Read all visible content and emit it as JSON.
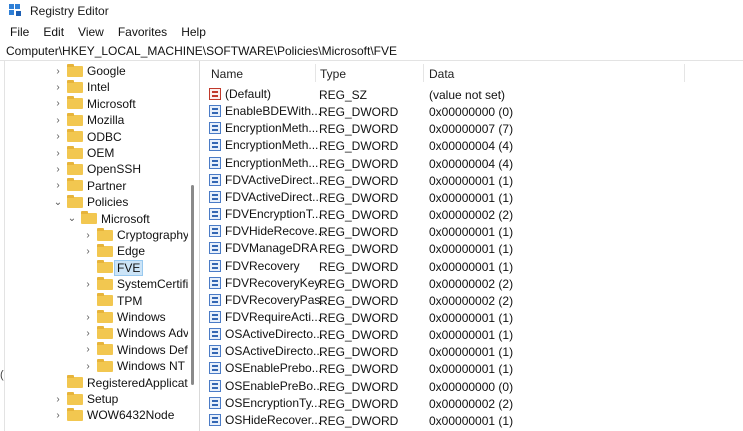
{
  "window": {
    "title": "Registry Editor"
  },
  "menu": [
    "File",
    "Edit",
    "View",
    "Favorites",
    "Help"
  ],
  "address": "Computer\\HKEY_LOCAL_MACHINE\\SOFTWARE\\Policies\\Microsoft\\FVE",
  "tree": [
    {
      "label": "Google",
      "depth": 0,
      "expander": "›"
    },
    {
      "label": "Intel",
      "depth": 0,
      "expander": "›"
    },
    {
      "label": "Microsoft",
      "depth": 0,
      "expander": "›"
    },
    {
      "label": "Mozilla",
      "depth": 0,
      "expander": "›"
    },
    {
      "label": "ODBC",
      "depth": 0,
      "expander": "›"
    },
    {
      "label": "OEM",
      "depth": 0,
      "expander": "›"
    },
    {
      "label": "OpenSSH",
      "depth": 0,
      "expander": "›"
    },
    {
      "label": "Partner",
      "depth": 0,
      "expander": "›"
    },
    {
      "label": "Policies",
      "depth": 0,
      "expander": "⌄"
    },
    {
      "label": "Microsoft",
      "depth": 1,
      "expander": "⌄"
    },
    {
      "label": "Cryptography",
      "depth": 2,
      "expander": "›"
    },
    {
      "label": "Edge",
      "depth": 2,
      "expander": "›"
    },
    {
      "label": "FVE",
      "depth": 2,
      "expander": "",
      "selected": true
    },
    {
      "label": "SystemCertific",
      "depth": 2,
      "expander": "›"
    },
    {
      "label": "TPM",
      "depth": 2,
      "expander": ""
    },
    {
      "label": "Windows",
      "depth": 2,
      "expander": "›"
    },
    {
      "label": "Windows Adva",
      "depth": 2,
      "expander": "›"
    },
    {
      "label": "Windows Defe",
      "depth": 2,
      "expander": "›"
    },
    {
      "label": "Windows NT",
      "depth": 2,
      "expander": "›"
    },
    {
      "label": "RegisteredApplicatic",
      "depth": 0,
      "expander": ""
    },
    {
      "label": "Setup",
      "depth": 0,
      "expander": "›"
    },
    {
      "label": "WOW6432Node",
      "depth": 0,
      "expander": "›"
    }
  ],
  "list": {
    "columns": {
      "name": "Name",
      "type": "Type",
      "data": "Data"
    },
    "rows": [
      {
        "name": "(Default)",
        "type": "REG_SZ",
        "data": "(value not set)",
        "icon": "string-value-icon"
      },
      {
        "name": "EnableBDEWith...",
        "type": "REG_DWORD",
        "data": "0x00000000 (0)",
        "icon": "binary-value-icon"
      },
      {
        "name": "EncryptionMeth...",
        "type": "REG_DWORD",
        "data": "0x00000007 (7)",
        "icon": "binary-value-icon"
      },
      {
        "name": "EncryptionMeth...",
        "type": "REG_DWORD",
        "data": "0x00000004 (4)",
        "icon": "binary-value-icon"
      },
      {
        "name": "EncryptionMeth...",
        "type": "REG_DWORD",
        "data": "0x00000004 (4)",
        "icon": "binary-value-icon"
      },
      {
        "name": "FDVActiveDirect...",
        "type": "REG_DWORD",
        "data": "0x00000001 (1)",
        "icon": "binary-value-icon"
      },
      {
        "name": "FDVActiveDirect...",
        "type": "REG_DWORD",
        "data": "0x00000001 (1)",
        "icon": "binary-value-icon"
      },
      {
        "name": "FDVEncryptionT...",
        "type": "REG_DWORD",
        "data": "0x00000002 (2)",
        "icon": "binary-value-icon"
      },
      {
        "name": "FDVHideRecove...",
        "type": "REG_DWORD",
        "data": "0x00000001 (1)",
        "icon": "binary-value-icon"
      },
      {
        "name": "FDVManageDRA",
        "type": "REG_DWORD",
        "data": "0x00000001 (1)",
        "icon": "binary-value-icon"
      },
      {
        "name": "FDVRecovery",
        "type": "REG_DWORD",
        "data": "0x00000001 (1)",
        "icon": "binary-value-icon"
      },
      {
        "name": "FDVRecoveryKey",
        "type": "REG_DWORD",
        "data": "0x00000002 (2)",
        "icon": "binary-value-icon"
      },
      {
        "name": "FDVRecoveryPas...",
        "type": "REG_DWORD",
        "data": "0x00000002 (2)",
        "icon": "binary-value-icon"
      },
      {
        "name": "FDVRequireActi...",
        "type": "REG_DWORD",
        "data": "0x00000001 (1)",
        "icon": "binary-value-icon"
      },
      {
        "name": "OSActiveDirecto...",
        "type": "REG_DWORD",
        "data": "0x00000001 (1)",
        "icon": "binary-value-icon"
      },
      {
        "name": "OSActiveDirecto...",
        "type": "REG_DWORD",
        "data": "0x00000001 (1)",
        "icon": "binary-value-icon"
      },
      {
        "name": "OSEnablePrebo...",
        "type": "REG_DWORD",
        "data": "0x00000001 (1)",
        "icon": "binary-value-icon"
      },
      {
        "name": "OSEnablePreBo...",
        "type": "REG_DWORD",
        "data": "0x00000000 (0)",
        "icon": "binary-value-icon"
      },
      {
        "name": "OSEncryptionTy...",
        "type": "REG_DWORD",
        "data": "0x00000002 (2)",
        "icon": "binary-value-icon"
      },
      {
        "name": "OSHideRecover...",
        "type": "REG_DWORD",
        "data": "0x00000001 (1)",
        "icon": "binary-value-icon"
      }
    ]
  },
  "edge_glyph": "("
}
